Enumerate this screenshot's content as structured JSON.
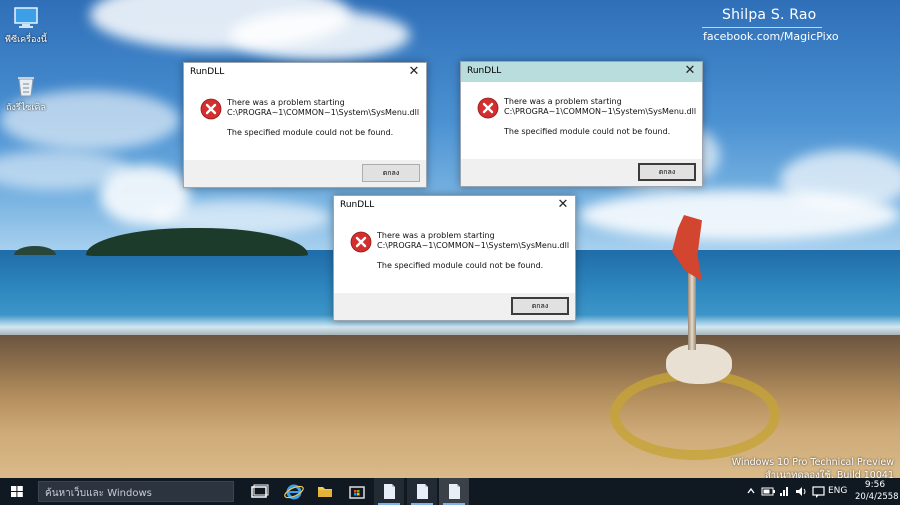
{
  "watermark": {
    "name": "Shilpa S. Rao",
    "link": "facebook.com/MagicPixo"
  },
  "desktop_icons": [
    {
      "label": "พีซีเครื่องนี้",
      "icon": "this-pc-icon"
    },
    {
      "label": "ถังรีไซเคิล",
      "icon": "recycle-bin-icon"
    }
  ],
  "build_info": {
    "line1": "Windows 10 Pro Technical Preview",
    "line2": "สำเนาทดลองใช้. Build 10041"
  },
  "dialogs": [
    {
      "title": "RunDLL",
      "line1": "There was a problem starting",
      "line2": "C:\\PROGRA~1\\COMMON~1\\System\\SysMenu.dll",
      "line3": "The specified module could not be found.",
      "button": "ตกลง",
      "active": false
    },
    {
      "title": "RunDLL",
      "line1": "There was a problem starting",
      "line2": "C:\\PROGRA~1\\COMMON~1\\System\\SysMenu.dll",
      "line3": "The specified module could not be found.",
      "button": "ตกลง",
      "active": true
    },
    {
      "title": "RunDLL",
      "line1": "There was a problem starting",
      "line2": "C:\\PROGRA~1\\COMMON~1\\System\\SysMenu.dll",
      "line3": "The specified module could not be found.",
      "button": "ตกลง",
      "active": false
    }
  ],
  "taskbar": {
    "search_placeholder": "ค้นหาเว็บและ Windows",
    "apps": [
      "task-view-icon",
      "internet-explorer-icon",
      "file-explorer-icon",
      "store-icon",
      "document-icon",
      "document-icon",
      "document-icon"
    ],
    "language": "ENG",
    "time": "9:56",
    "date": "20/4/2558"
  },
  "colors": {
    "active_titlebar": "#b9dcdc",
    "taskbar": "#101822",
    "error_red": "#d32f2f"
  }
}
